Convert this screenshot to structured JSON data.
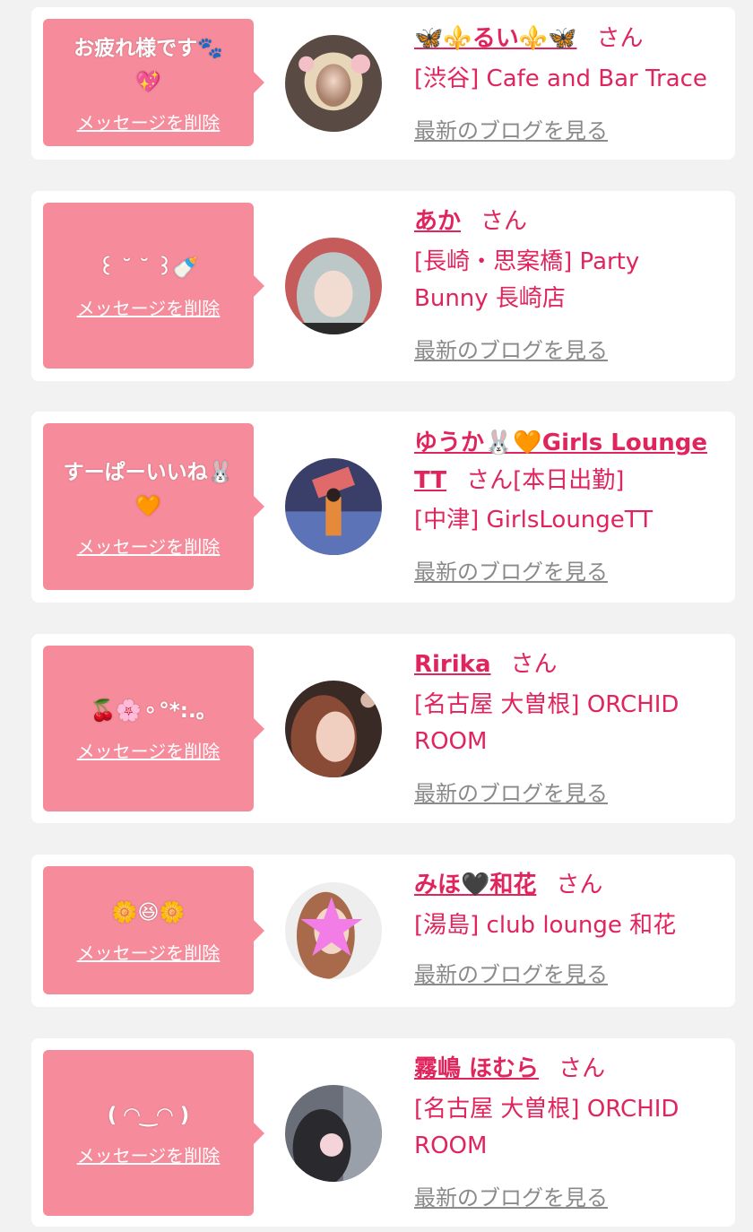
{
  "delete_label": "メッセージを削除",
  "blog_label": "最新のブログを見る",
  "san_label": "さん",
  "colors": {
    "accent": "#e0245e",
    "bubble": "#f68c9b",
    "muted": "#8a8a8a",
    "background": "#f2f2f2"
  },
  "cards": [
    {
      "message_l1": "お疲れ様です🐾",
      "message_l2": "💖",
      "name": "🦋⚜️るい⚜️🦋",
      "san": "さん",
      "suffix": "",
      "shop_l1": "[渋谷] Cafe and Bar Trace",
      "shop_l2": ""
    },
    {
      "message_l1": "꒰ ˘ ˘ ꒱🍼",
      "message_l2": "",
      "name": "あか",
      "san": "さん",
      "suffix": "",
      "shop_l1": "[長崎・思案橋] Party",
      "shop_l2": "Bunny 長崎店"
    },
    {
      "message_l1": "すーぱーいいね🐰",
      "message_l2": "🧡",
      "name_l1": "ゆうか🐰🧡Girls Lounge",
      "name_l2": "TT",
      "san": "さん",
      "suffix": "[本日出勤]",
      "shop_l1": "[中津] GirlsLoungeTT",
      "shop_l2": ""
    },
    {
      "message_l1": "🍒🌸⚬°*:.｡",
      "message_l2": "",
      "name": "Ririka",
      "san": "さん",
      "suffix": "",
      "shop_l1": "[名古屋 大曽根] ORCHID",
      "shop_l2": "ROOM"
    },
    {
      "message_l1": "🌼😆🌼",
      "message_l2": "",
      "name": "みほ🖤和花",
      "san": "さん",
      "suffix": "",
      "shop_l1": "[湯島] club lounge 和花",
      "shop_l2": ""
    },
    {
      "message_l1": "( ◠‿◠ )",
      "message_l2": "",
      "name": "霧嶋 ほむら",
      "san": "さん",
      "suffix": "",
      "shop_l1": "[名古屋 大曽根] ORCHID",
      "shop_l2": "ROOM"
    }
  ]
}
